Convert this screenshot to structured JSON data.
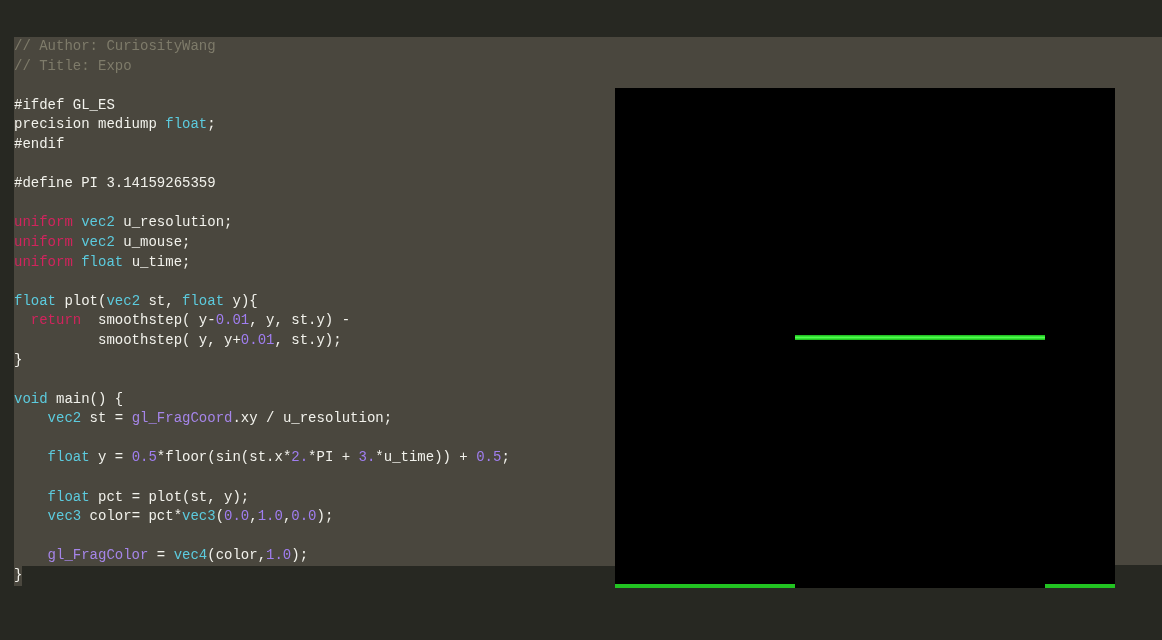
{
  "editor": {
    "lines": [
      {
        "kind": "code",
        "selected": true,
        "tokens": [
          {
            "kind": "comment",
            "text": "// Author: CuriosityWang"
          }
        ]
      },
      {
        "kind": "code",
        "selected": true,
        "tokens": [
          {
            "kind": "comment",
            "text": "// Title: Expo"
          }
        ]
      },
      {
        "kind": "blank",
        "selected": true
      },
      {
        "kind": "code",
        "selected": true,
        "tokens": [
          {
            "kind": "plain",
            "text": "#ifdef GL_ES"
          }
        ]
      },
      {
        "kind": "code",
        "selected": true,
        "tokens": [
          {
            "kind": "plain",
            "text": "precision mediump "
          },
          {
            "kind": "type",
            "text": "float"
          },
          {
            "kind": "plain",
            "text": ";"
          }
        ]
      },
      {
        "kind": "code",
        "selected": true,
        "tokens": [
          {
            "kind": "plain",
            "text": "#endif"
          }
        ]
      },
      {
        "kind": "blank",
        "selected": true
      },
      {
        "kind": "code",
        "selected": true,
        "tokens": [
          {
            "kind": "plain",
            "text": "#define PI 3.14159265359"
          }
        ]
      },
      {
        "kind": "blank",
        "selected": true
      },
      {
        "kind": "code",
        "selected": true,
        "tokens": [
          {
            "kind": "keyword",
            "text": "uniform"
          },
          {
            "kind": "type",
            "text": " vec2"
          },
          {
            "kind": "plain",
            "text": " u_resolution;"
          }
        ]
      },
      {
        "kind": "code",
        "selected": true,
        "tokens": [
          {
            "kind": "keyword",
            "text": "uniform"
          },
          {
            "kind": "type",
            "text": " vec2"
          },
          {
            "kind": "plain",
            "text": " u_mouse;"
          }
        ]
      },
      {
        "kind": "code",
        "selected": true,
        "tokens": [
          {
            "kind": "keyword",
            "text": "uniform"
          },
          {
            "kind": "type",
            "text": " float"
          },
          {
            "kind": "plain",
            "text": " u_time;"
          }
        ]
      },
      {
        "kind": "blank",
        "selected": true
      },
      {
        "kind": "code",
        "selected": true,
        "tokens": [
          {
            "kind": "type",
            "text": "float"
          },
          {
            "kind": "plain",
            "text": " plot("
          },
          {
            "kind": "type",
            "text": "vec2"
          },
          {
            "kind": "plain",
            "text": " st, "
          },
          {
            "kind": "type",
            "text": "float"
          },
          {
            "kind": "plain",
            "text": " y){"
          }
        ]
      },
      {
        "kind": "code",
        "selected": true,
        "tokens": [
          {
            "kind": "keyword",
            "text": "  return"
          },
          {
            "kind": "plain",
            "text": "  smoothstep( y-"
          },
          {
            "kind": "number",
            "text": "0.01"
          },
          {
            "kind": "plain",
            "text": ", y, st.y) -"
          }
        ]
      },
      {
        "kind": "code",
        "selected": true,
        "tokens": [
          {
            "kind": "plain",
            "text": "          smoothstep( y, y+"
          },
          {
            "kind": "number",
            "text": "0.01"
          },
          {
            "kind": "plain",
            "text": ", st.y);"
          }
        ]
      },
      {
        "kind": "code",
        "selected": true,
        "tokens": [
          {
            "kind": "plain",
            "text": "}"
          }
        ]
      },
      {
        "kind": "blank",
        "selected": true
      },
      {
        "kind": "code",
        "selected": true,
        "tokens": [
          {
            "kind": "type",
            "text": "void"
          },
          {
            "kind": "plain",
            "text": " main() {"
          }
        ]
      },
      {
        "kind": "code",
        "selected": true,
        "tokens": [
          {
            "kind": "type",
            "text": "    vec2"
          },
          {
            "kind": "plain",
            "text": " st = "
          },
          {
            "kind": "builtin",
            "text": "gl_FragCoord"
          },
          {
            "kind": "plain",
            "text": ".xy / u_resolution;"
          }
        ]
      },
      {
        "kind": "blank",
        "selected": true
      },
      {
        "kind": "code",
        "selected": true,
        "tokens": [
          {
            "kind": "type",
            "text": "    float"
          },
          {
            "kind": "plain",
            "text": " y = "
          },
          {
            "kind": "number",
            "text": "0.5"
          },
          {
            "kind": "plain",
            "text": "*floor(sin(st.x*"
          },
          {
            "kind": "number",
            "text": "2."
          },
          {
            "kind": "plain",
            "text": "*PI + "
          },
          {
            "kind": "number",
            "text": "3."
          },
          {
            "kind": "plain",
            "text": "*u_time)) + "
          },
          {
            "kind": "number",
            "text": "0.5"
          },
          {
            "kind": "plain",
            "text": ";"
          }
        ]
      },
      {
        "kind": "blank",
        "selected": true
      },
      {
        "kind": "code",
        "selected": true,
        "tokens": [
          {
            "kind": "type",
            "text": "    float"
          },
          {
            "kind": "plain",
            "text": " pct = plot(st, y);"
          }
        ]
      },
      {
        "kind": "code",
        "selected": true,
        "tokens": [
          {
            "kind": "type",
            "text": "    vec3"
          },
          {
            "kind": "plain",
            "text": " color= pct*"
          },
          {
            "kind": "type",
            "text": "vec3"
          },
          {
            "kind": "plain",
            "text": "("
          },
          {
            "kind": "number",
            "text": "0.0"
          },
          {
            "kind": "plain",
            "text": ","
          },
          {
            "kind": "number",
            "text": "1.0"
          },
          {
            "kind": "plain",
            "text": ","
          },
          {
            "kind": "number",
            "text": "0.0"
          },
          {
            "kind": "plain",
            "text": ");"
          }
        ]
      },
      {
        "kind": "blank",
        "selected": true
      },
      {
        "kind": "code",
        "selected": true,
        "tokens": [
          {
            "kind": "builtin",
            "text": "    gl_FragColor"
          },
          {
            "kind": "plain",
            "text": " = "
          },
          {
            "kind": "type",
            "text": "vec4"
          },
          {
            "kind": "plain",
            "text": "(color,"
          },
          {
            "kind": "number",
            "text": "1.0"
          },
          {
            "kind": "plain",
            "text": ");"
          }
        ]
      },
      {
        "kind": "code",
        "selected": true,
        "tokens": [
          {
            "kind": "plain",
            "text": "}"
          }
        ]
      }
    ]
  }
}
